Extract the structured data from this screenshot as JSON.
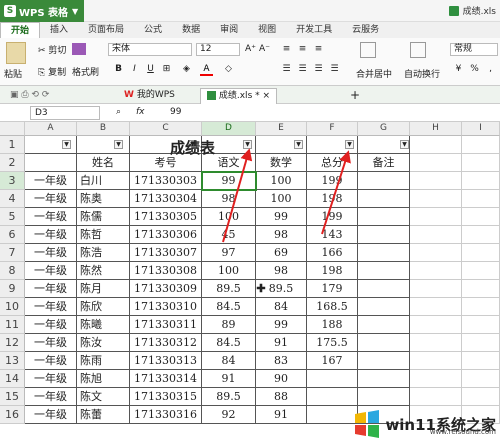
{
  "app": {
    "name": "WPS 表格",
    "doc_title": "成绩.xls"
  },
  "menu": [
    "开始",
    "插入",
    "页面布局",
    "公式",
    "数据",
    "审阅",
    "视图",
    "开发工具",
    "云服务"
  ],
  "ribbon": {
    "cut": "剪切",
    "paste": "粘贴",
    "copy": "复制",
    "format_painter": "格式刷",
    "font": "宋体",
    "font_size": "12",
    "merge": "合并居中",
    "wrap": "自动换行",
    "number_format": "常规"
  },
  "tabs": {
    "wps": "我的WPS",
    "file": "成绩.xls *",
    "add": "+"
  },
  "formula": {
    "cell_ref": "D3",
    "fx": "fx",
    "value": "99"
  },
  "columns": [
    "A",
    "B",
    "C",
    "D",
    "E",
    "F",
    "G",
    "H",
    "I"
  ],
  "rows": [
    "1",
    "2",
    "3",
    "4",
    "5",
    "6",
    "7",
    "8",
    "9",
    "10",
    "11",
    "12",
    "13",
    "14",
    "15",
    "16"
  ],
  "sheet": {
    "title": "成绩表",
    "headers": [
      "",
      "姓名",
      "考号",
      "语文",
      "数学",
      "总分",
      "备注"
    ],
    "data": [
      [
        "一年级",
        "白川",
        "171330303",
        "99",
        "100",
        "199"
      ],
      [
        "一年级",
        "陈奥",
        "171330304",
        "98",
        "100",
        "198"
      ],
      [
        "一年级",
        "陈儒",
        "171330305",
        "100",
        "99",
        "199"
      ],
      [
        "一年级",
        "陈哲",
        "171330306",
        "45",
        "98",
        "143"
      ],
      [
        "一年级",
        "陈浩",
        "171330307",
        "97",
        "69",
        "166"
      ],
      [
        "一年级",
        "陈然",
        "171330308",
        "100",
        "98",
        "198"
      ],
      [
        "一年级",
        "陈月",
        "171330309",
        "89.5",
        "89.5",
        "179"
      ],
      [
        "一年级",
        "陈欣",
        "171330310",
        "84.5",
        "84",
        "168.5"
      ],
      [
        "一年级",
        "陈曦",
        "171330311",
        "89",
        "99",
        "188"
      ],
      [
        "一年级",
        "陈汝",
        "171330312",
        "84.5",
        "91",
        "175.5"
      ],
      [
        "一年级",
        "陈雨",
        "171330313",
        "84",
        "83",
        "167"
      ],
      [
        "一年级",
        "陈旭",
        "171330314",
        "91",
        "90",
        ""
      ],
      [
        "一年级",
        "陈文",
        "171330315",
        "89.5",
        "88",
        ""
      ],
      [
        "一年级",
        "陈蕾",
        "171330316",
        "92",
        "91",
        ""
      ]
    ],
    "col1_label": "一年级"
  },
  "watermark": {
    "text": "win11系统之家",
    "url": "www.relsound.com"
  },
  "colors": {
    "accent": "#2e8b2e",
    "arrow": "#e02020"
  }
}
